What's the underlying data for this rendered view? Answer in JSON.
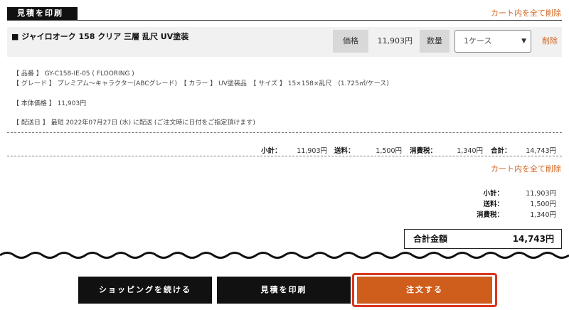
{
  "header": {
    "print_tag": "見積を印刷",
    "delete_all": "カート内を全て削除"
  },
  "item": {
    "name": "■ ジャイロオーク 158 クリア 三層 乱尺 UV塗装",
    "price_label": "価格",
    "price_value": "11,903円",
    "qty_label": "数量",
    "qty_selected": "1ケース",
    "delete": "削除",
    "details": {
      "line1": "【 品番 】 GY-C158-IE-05 ( FLOORING )",
      "line2": "【 グレード 】 プレミアム～キャラクター(ABCグレード)　【 カラー 】 UV塗装品　【 サイズ 】 15×158×乱尺　(1.725㎡/ケース)",
      "line3": "【 本体価格 】 11,903円",
      "line4": "【 配送日 】 最短 2022年07月27日 (水) に配送 (ご注文時に日付をご指定頂けます)"
    },
    "subtotals": {
      "subtotal_label": "小計：",
      "subtotal_value": "11,903円",
      "shipping_label": "送料：",
      "shipping_value": "1,500円",
      "tax_label": "消費税：",
      "tax_value": "1,340円",
      "total_label": "合計：",
      "total_value": "14,743円"
    }
  },
  "cart_delete_all": "カート内を全て削除",
  "summary": {
    "subtotal_label": "小計：",
    "subtotal_value": "11,903円",
    "shipping_label": "送料：",
    "shipping_value": "1,500円",
    "tax_label": "消費税：",
    "tax_value": "1,340円",
    "grand_label": "合計金額",
    "grand_value": "14,743円"
  },
  "actions": {
    "continue_shopping": "ショッピングを続ける",
    "print_estimate": "見積を印刷",
    "order": "注文する"
  },
  "colors": {
    "accent": "#cf5d1b",
    "link": "#d2651f",
    "highlight_outline": "#d9361f"
  }
}
